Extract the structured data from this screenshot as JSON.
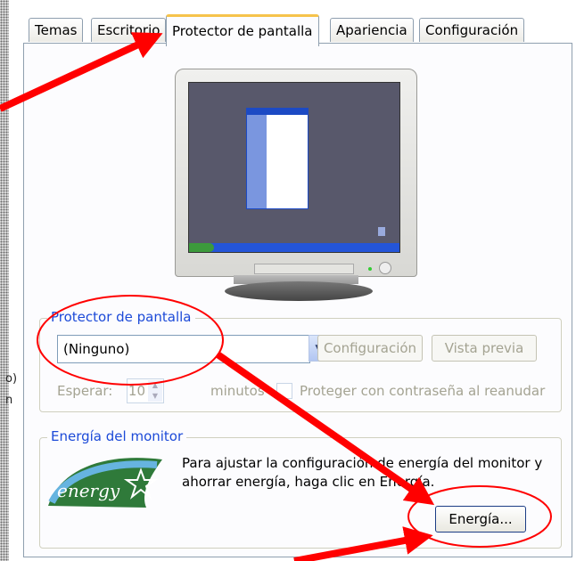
{
  "tabs": [
    {
      "label": "Temas",
      "active": false
    },
    {
      "label": "Escritorio",
      "active": false
    },
    {
      "label": "Protector de pantalla",
      "active": true
    },
    {
      "label": "Apariencia",
      "active": false
    },
    {
      "label": "Configuración",
      "active": false
    }
  ],
  "background": {
    "fragment_1": "o)",
    "fragment_2": "n"
  },
  "screensaver": {
    "group_title": "Protector de pantalla",
    "selected": "(Ninguno)",
    "settings_button": "Configuración",
    "preview_button": "Vista previa",
    "wait_label": "Esperar:",
    "wait_value": "10",
    "minutes_label": "minutos",
    "password_label": "Proteger con contraseña al reanudar",
    "password_checked": false
  },
  "monitor_power": {
    "group_title": "Energía del monitor",
    "description": "Para ajustar la configuración de energía del monitor y ahorrar energía, haga clic en Energía.",
    "power_button": "Energía...",
    "logo_text": "energy"
  },
  "colors": {
    "accent_tab": "#f6c34b",
    "group_title": "#1c4ad8",
    "annotation_red": "#ff0000",
    "screen": "#58586b"
  },
  "icons": {
    "dropdown": "chevron-down-icon",
    "spinner": "up-down-arrows-icon"
  }
}
